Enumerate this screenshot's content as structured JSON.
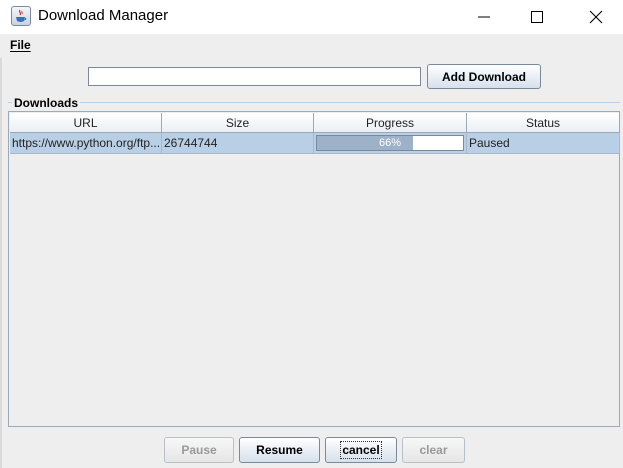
{
  "window": {
    "title": "Download Manager",
    "app_icon": "java-cup-icon",
    "controls": [
      "minimize-icon",
      "maximize-icon",
      "close-icon"
    ]
  },
  "menu": {
    "file_label": "File"
  },
  "toolbar": {
    "url_input_value": "",
    "add_download_label": "Add Download"
  },
  "downloads": {
    "group_label": "Downloads",
    "columns": [
      "URL",
      "Size",
      "Progress",
      "Status"
    ],
    "rows": [
      {
        "url": "https://www.python.org/ftp...",
        "size": "26744744",
        "progress": 66,
        "progress_text": "66%",
        "status": "Paused"
      }
    ],
    "selection_color": "#b8cfe5",
    "progress_fill_color": "#9db1c9"
  },
  "actions": {
    "pause_label": "Pause",
    "resume_label": "Resume",
    "cancel_label": "cancel",
    "clear_label": "clear"
  }
}
